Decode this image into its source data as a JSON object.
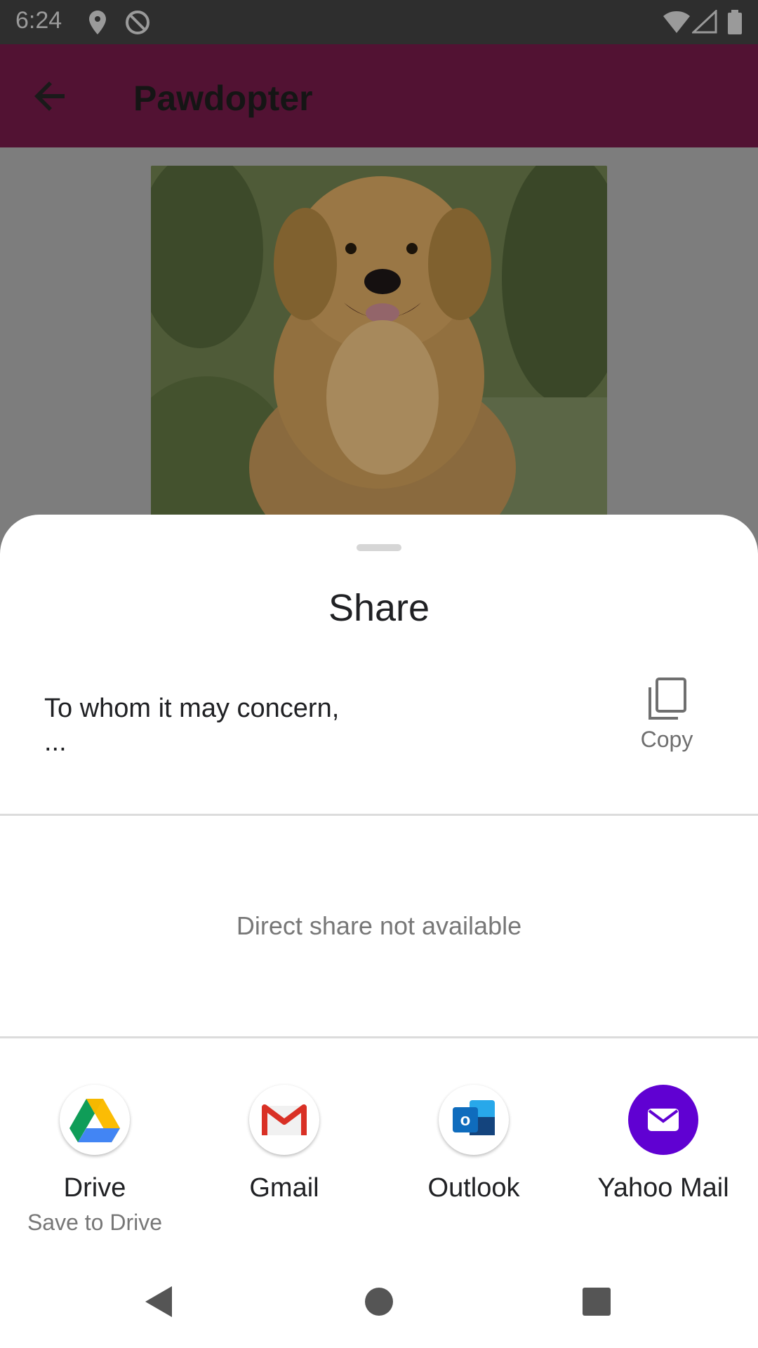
{
  "status_bar": {
    "time": "6:24"
  },
  "app_bar": {
    "title": "Pawdopter"
  },
  "share_sheet": {
    "title": "Share",
    "preview_text": "To whom it may concern,\n...",
    "copy_label": "Copy",
    "direct_share_message": "Direct share not available",
    "targets": [
      {
        "name": "Drive",
        "subtitle": "Save to Drive",
        "icon": "google-drive-icon"
      },
      {
        "name": "Gmail",
        "subtitle": "",
        "icon": "gmail-icon"
      },
      {
        "name": "Outlook",
        "subtitle": "",
        "icon": "outlook-icon"
      },
      {
        "name": "Yahoo Mail",
        "subtitle": "",
        "icon": "yahoo-mail-icon"
      }
    ]
  },
  "colors": {
    "app_bar": "#521233",
    "yahoo_purple": "#6001d2",
    "outlook_blue": "#0f6cbd"
  }
}
